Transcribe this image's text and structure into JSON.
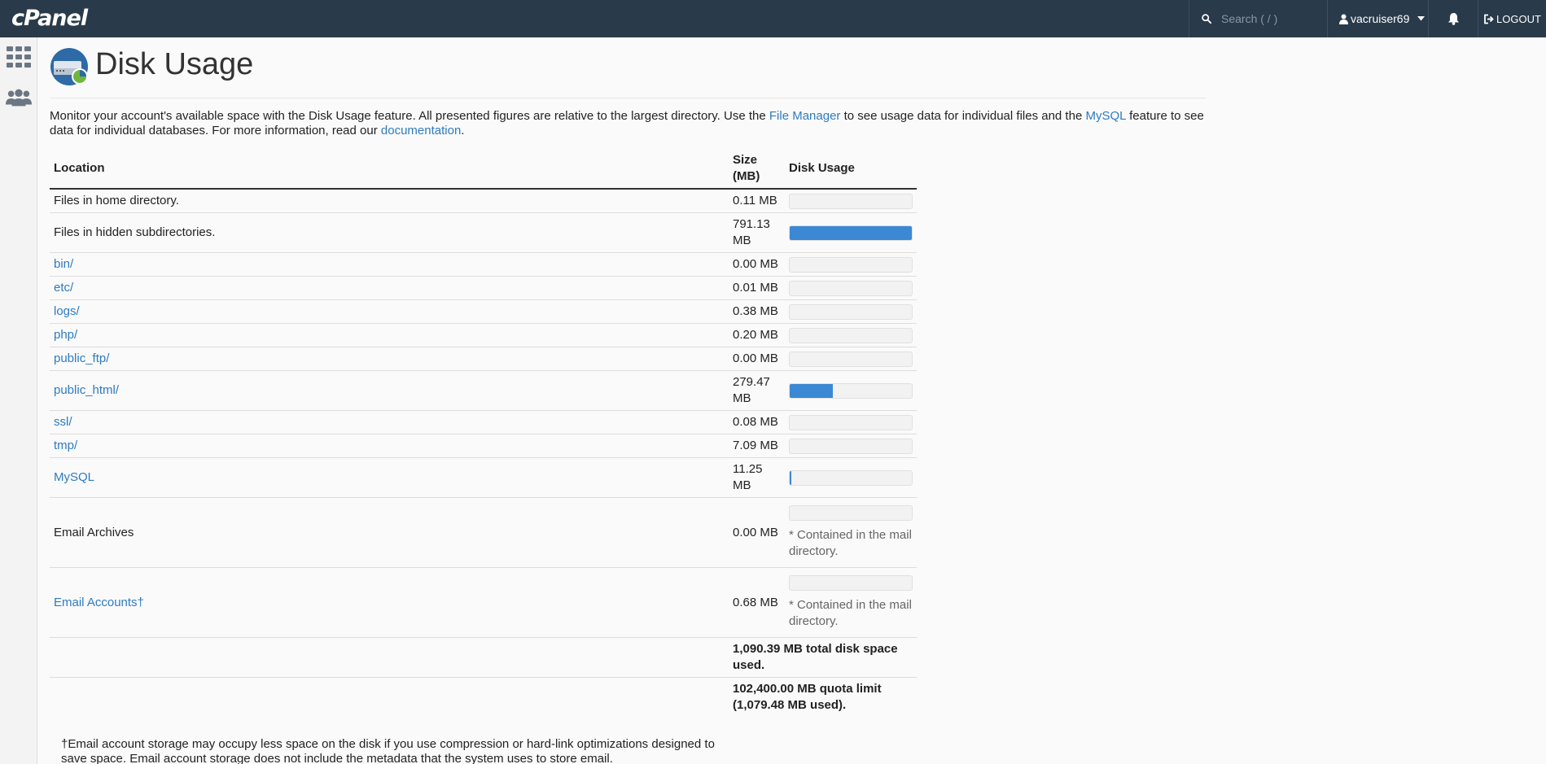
{
  "topbar": {
    "logo": "cPanel",
    "search_placeholder": "Search ( / )",
    "username": "vacruiser69",
    "logout_label": "LOGOUT"
  },
  "sidebar": {
    "items": [
      {
        "name": "home",
        "icon": "grid-icon"
      },
      {
        "name": "users",
        "icon": "users-icon"
      }
    ]
  },
  "page": {
    "title": "Disk Usage",
    "intro": {
      "part1": "Monitor your account's available space with the Disk Usage feature. All presented figures are relative to the largest directory. Use the ",
      "link1": "File Manager",
      "part2": " to see usage data for individual files and the ",
      "link2": "MySQL",
      "part3": " feature to see data for individual databases. For more information, read our ",
      "link3": "documentation",
      "part4": "."
    }
  },
  "table": {
    "headers": {
      "location": "Location",
      "size": "Size (MB)",
      "usage": "Disk Usage"
    },
    "rows": [
      {
        "location": "Files in home directory.",
        "link": false,
        "size": "0.11 MB",
        "fraction": 0.0
      },
      {
        "location": "Files in hidden subdirectories.",
        "link": false,
        "size": "791.13 MB",
        "fraction": 1.0
      },
      {
        "location": "bin/",
        "link": true,
        "size": "0.00 MB",
        "fraction": 0.0
      },
      {
        "location": "etc/",
        "link": true,
        "size": "0.01 MB",
        "fraction": 0.0
      },
      {
        "location": "logs/",
        "link": true,
        "size": "0.38 MB",
        "fraction": 0.0
      },
      {
        "location": "php/",
        "link": true,
        "size": "0.20 MB",
        "fraction": 0.0
      },
      {
        "location": "public_ftp/",
        "link": true,
        "size": "0.00 MB",
        "fraction": 0.0
      },
      {
        "location": "public_html/",
        "link": true,
        "size": "279.47 MB",
        "fraction": 0.353
      },
      {
        "location": "ssl/",
        "link": true,
        "size": "0.08 MB",
        "fraction": 0.0
      },
      {
        "location": "tmp/",
        "link": true,
        "size": "7.09 MB",
        "fraction": 0.0
      },
      {
        "location": "MySQL",
        "link": true,
        "size": "11.25 MB",
        "fraction": 0.014
      },
      {
        "location": "Email Archives",
        "link": false,
        "size": "0.00 MB",
        "fraction": 0.0,
        "note": "* Contained in the mail directory."
      },
      {
        "location": "Email Accounts†",
        "link": true,
        "size": "0.68 MB",
        "fraction": 0.0,
        "note": "* Contained in the mail directory."
      }
    ],
    "total": "1,090.39 MB total disk space used.",
    "quota": "102,400.00 MB quota limit (1,079.48 MB used)."
  },
  "footnote": "†Email account storage may occupy less space on the disk if you use compression or hard-link optimizations designed to save space. Email account storage does not include the metadata that the system uses to store email.",
  "colors": {
    "topbar": "#293a4a",
    "link": "#2e7bbf",
    "bar_fill": "#3b88d4"
  }
}
